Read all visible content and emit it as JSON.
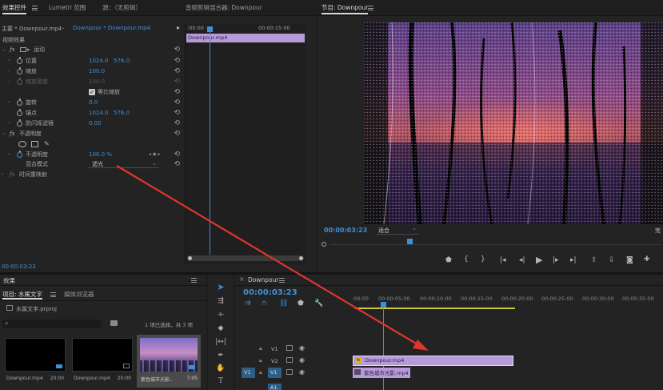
{
  "effect_controls": {
    "tabs": [
      "效果控件",
      "Lumetri 范围",
      "源：（无剪辑）",
      "音频剪辑混合器: Downpour"
    ],
    "source_master": "主要 * Downpour.mp4",
    "source_clip": "Downpour * Downpour.mp4",
    "video_effects": "视频效果",
    "motion": "运动",
    "position_label": "位置",
    "position_x": "1024.0",
    "position_y": "576.0",
    "scale_label": "缩放",
    "scale_value": "100.0",
    "scale_width_label": "缩放宽度",
    "scale_width_value": "100.0",
    "uniform_scale": "等比缩放",
    "rotation_label": "旋转",
    "rotation_value": "0.0",
    "anchor_label": "锚点",
    "anchor_x": "1024.0",
    "anchor_y": "576.0",
    "antiflicker_label": "防闪烁滤镜",
    "antiflicker_value": "0.00",
    "opacity_group": "不透明度",
    "opacity_label": "不透明度",
    "opacity_value": "100.0 %",
    "blend_label": "混合模式",
    "blend_value": "滤光",
    "time_remap": "时间重映射",
    "timecode": "00:00:03:23",
    "mini_timeline_start": ":00:00",
    "mini_timeline_end": "00:00:15:00",
    "mini_clip_name": "Downpour.mp4",
    "fx_badge": "fx"
  },
  "program": {
    "title": "节目: Downpour",
    "timecode": "00:00:03:23",
    "fit": "适合",
    "quality": "完"
  },
  "effects_panel": {
    "title": "效果"
  },
  "project": {
    "tabs": [
      "项目: 水属文字",
      "媒体浏览器"
    ],
    "file": "水属文字.prproj",
    "selection": "1 项已选择，共 3 项",
    "items": [
      {
        "name": "Downpour.mp4",
        "duration": "20:00"
      },
      {
        "name": "Downpour.mp4",
        "duration": "20:00"
      },
      {
        "name": "紫色城市光影..",
        "duration": "7:05"
      }
    ]
  },
  "timeline": {
    "title": "Downpour",
    "timecode": "00:00:03:23",
    "ruler": [
      ":00:00",
      "00:00:05:00",
      "00:00:10:00",
      "00:00:15:00",
      "00:00:20:00",
      "00:00:25:00",
      "00:00:30:00",
      "00:00:35:00"
    ],
    "tracks": [
      "V1",
      "V2",
      "V1"
    ],
    "src_patch": "V1",
    "audio_track": "A1",
    "clip_top": "Downpour.mp4",
    "clip_bottom": "紫色城市光影.mp4",
    "fx_badge": "fx"
  },
  "colors": {
    "accent": "#3d8fd8",
    "clip_purple": "#b79bd9",
    "arrow": "#e0352b",
    "work_area": "#c8c83a"
  },
  "icons": [
    "menu-icon",
    "search-icon",
    "folder-icon",
    "play-icon",
    "step-back-icon",
    "step-forward-icon",
    "go-to-in-icon",
    "go-to-out-icon",
    "marker-icon",
    "camera-icon",
    "wrench-icon",
    "eye-icon",
    "lock-icon",
    "selection-tool-icon",
    "hand-tool-icon",
    "type-tool-icon",
    "pen-tool-icon",
    "razor-tool-icon"
  ]
}
